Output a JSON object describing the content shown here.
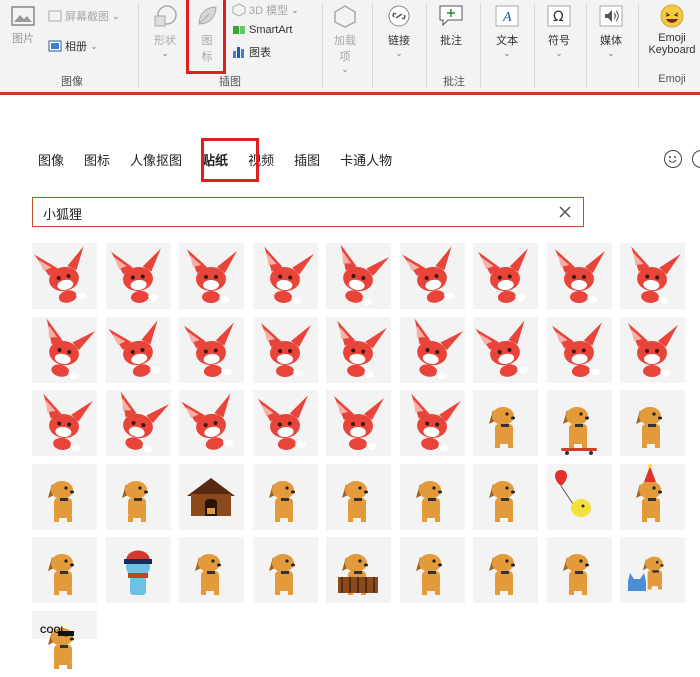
{
  "ribbon": {
    "images_group": {
      "picture_label": "图片",
      "screenshot_label": "屏幕截图",
      "album_label": "相册",
      "group_label": "图像"
    },
    "illustrations_group": {
      "shapes_label": "形状",
      "icons_label_line1": "图",
      "icons_label_line2": "标",
      "model3d_label": "3D 模型",
      "smartart_label": "SmartArt",
      "chart_label": "图表",
      "group_label": "插图"
    },
    "addins_group": {
      "label_line1": "加载",
      "label_line2": "项"
    },
    "links_group": {
      "link_label": "链接"
    },
    "comments_group": {
      "comment_label": "批注",
      "group_label": "批注"
    },
    "text_group": {
      "text_label": "文本"
    },
    "symbols_group": {
      "symbols_label": "符号"
    },
    "media_group": {
      "media_label": "媒体"
    },
    "emoji_group": {
      "label_line1": "Emoji",
      "label_line2": "Keyboard",
      "group_label": "Emoji"
    }
  },
  "tabs": [
    "图像",
    "图标",
    "人像抠图",
    "贴纸",
    "视频",
    "插图",
    "卡通人物"
  ],
  "active_tab": "贴纸",
  "search": {
    "value": "小狐狸"
  },
  "colors": {
    "accent": "#c43e1c",
    "highlight_box": "#e21f1f",
    "fox": "#e8443a",
    "dog": "#e39a3a"
  },
  "stickers": [
    "fox",
    "fox",
    "fox",
    "fox",
    "fox",
    "fox",
    "fox",
    "fox",
    "fox",
    "fox",
    "fox",
    "fox",
    "fox",
    "fox",
    "fox",
    "fox",
    "fox",
    "fox",
    "fox",
    "fox",
    "fox",
    "fox",
    "fox",
    "fox",
    "dog",
    "dog-skateboard",
    "dog",
    "dog",
    "dog",
    "dog-house",
    "dog",
    "dog",
    "dog",
    "dog",
    "dog-balloon",
    "dog-party",
    "dog",
    "dog-hat",
    "dog",
    "dog",
    "dog-fence",
    "dog",
    "dog",
    "dog",
    "dog-cat",
    "dog-cool"
  ],
  "sticker_cool_text": "COOL"
}
